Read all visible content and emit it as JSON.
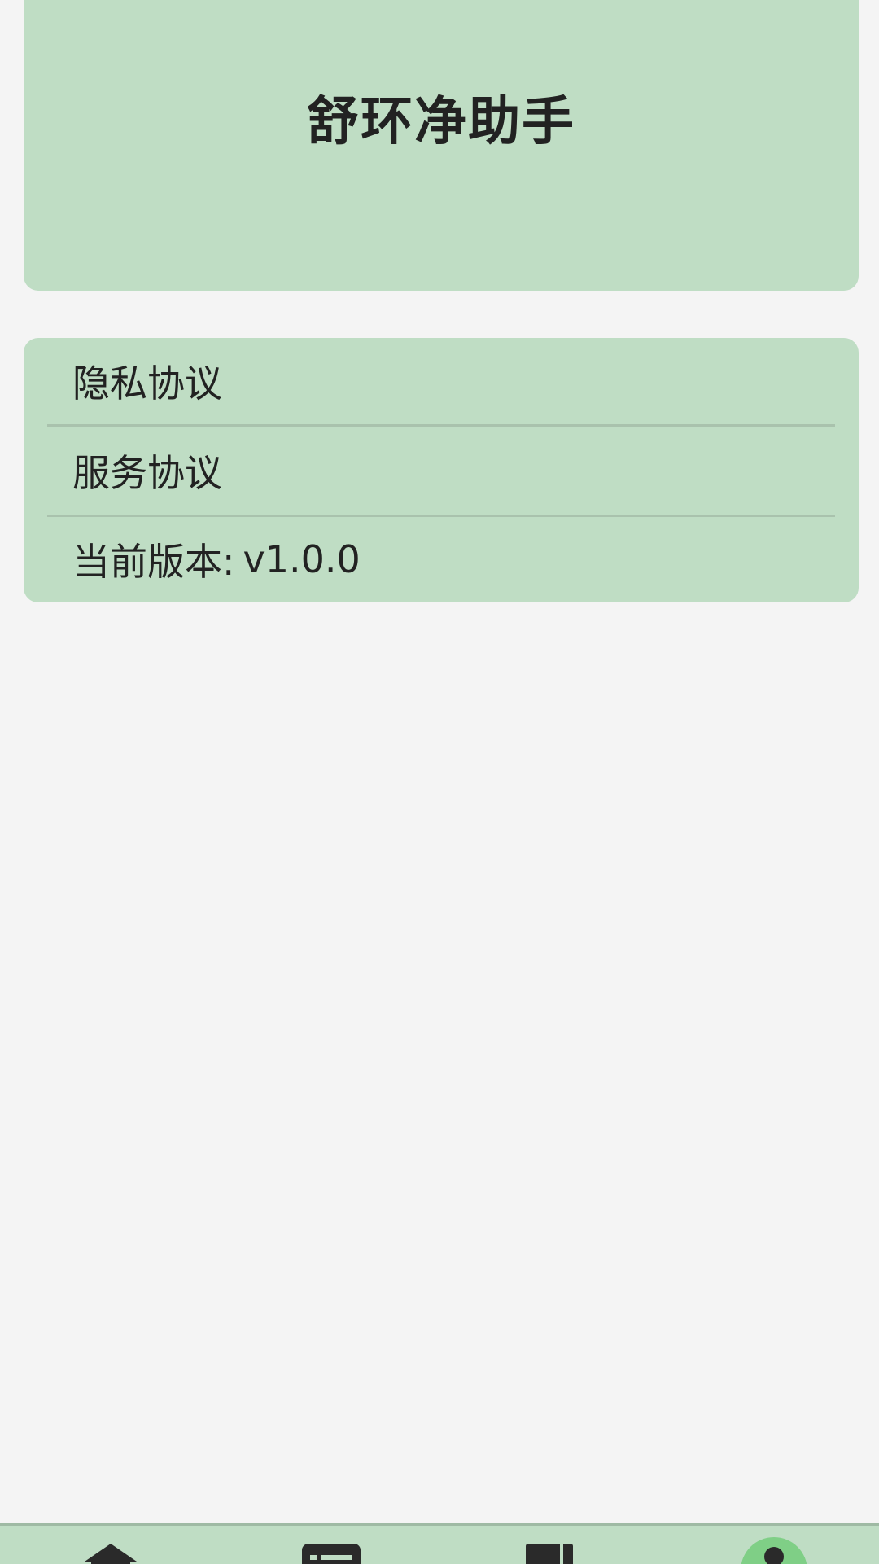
{
  "header": {
    "app_title": "舒环净助手"
  },
  "menu": {
    "items": [
      {
        "label": "隐私协议"
      },
      {
        "label": "服务协议"
      }
    ],
    "version": {
      "label": "当前版本:",
      "value": "v1.0.0"
    }
  },
  "tabbar": {
    "tabs": [
      {
        "icon": "home-icon"
      },
      {
        "icon": "list-icon"
      },
      {
        "icon": "book-icon"
      },
      {
        "icon": "profile-icon",
        "active": true
      }
    ],
    "active_color": "#7fcf86"
  }
}
